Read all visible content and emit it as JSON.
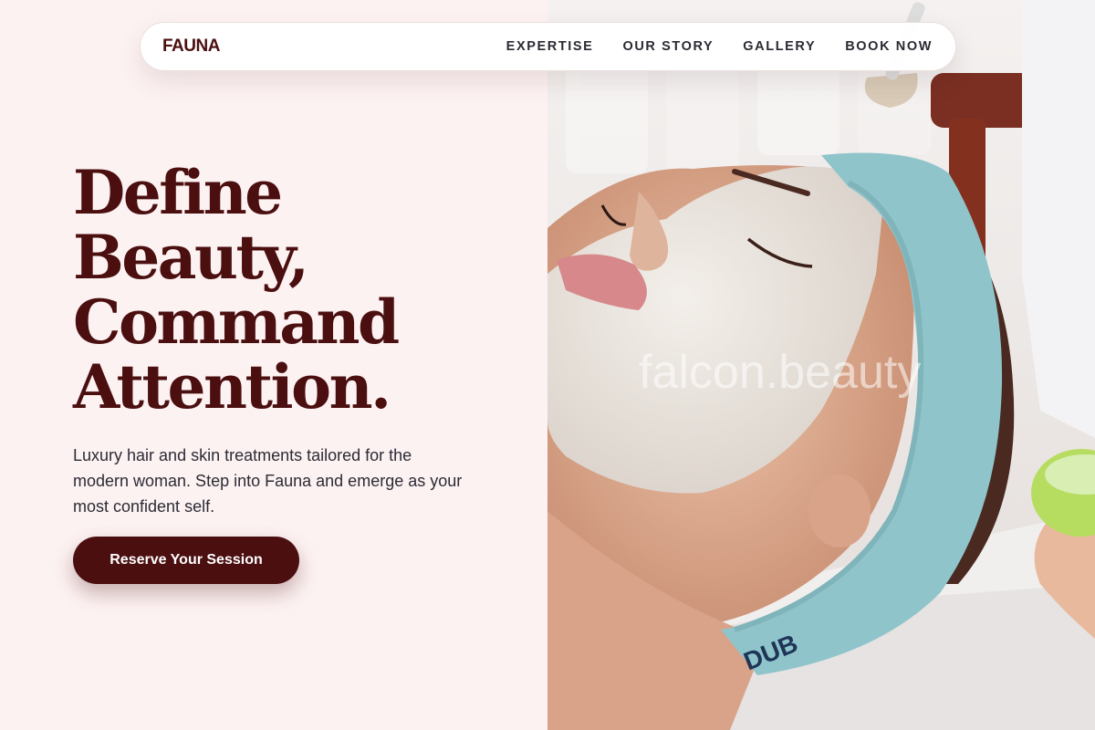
{
  "brand": {
    "logo": "FAUNA"
  },
  "nav": {
    "items": [
      {
        "label": "EXPERTISE"
      },
      {
        "label": "OUR STORY"
      },
      {
        "label": "GALLERY"
      },
      {
        "label": "BOOK NOW"
      }
    ]
  },
  "hero": {
    "headline": [
      "Define",
      "Beauty,",
      "Command",
      "Attention."
    ],
    "subtext": "Luxury hair and skin treatments tailored for the modern woman. Step into Fauna and emerge as your most confident self.",
    "cta_label": "Reserve Your Session"
  },
  "image": {
    "watermark": "falcon.beauty",
    "towel_text": "DUB"
  },
  "colors": {
    "brand": "#4b0f10",
    "background": "#fdf2f2",
    "nav_text": "#2a2a33",
    "towel": "#8fc4cb"
  }
}
